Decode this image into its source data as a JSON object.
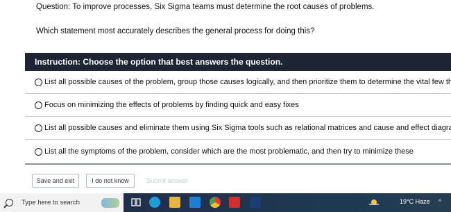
{
  "question": {
    "line1": "Question: To improve processes, Six Sigma teams must determine the root causes of problems.",
    "line2": "Which statement most accurately describes the general process for doing this?"
  },
  "instruction": "Instruction: Choose the option that best answers the question.",
  "options": [
    "List all possible causes of the problem, group those causes logically, and then prioritize them to determine the vital few that re",
    "Focus on minimizing the effects of problems by finding quick and easy fixes",
    "List all possible causes and eliminate them using Six Sigma tools such as relational matrices and cause and effect diagrams",
    "List all the symptoms of the problem, consider which are the most problematic, and then try to minimize these"
  ],
  "buttons": {
    "save_exit": "Save and exit",
    "dont_know": "I do not know",
    "submit": "Submit answer"
  },
  "taskbar": {
    "search_placeholder": "Type here to search",
    "weather": "19°C  Haze"
  }
}
